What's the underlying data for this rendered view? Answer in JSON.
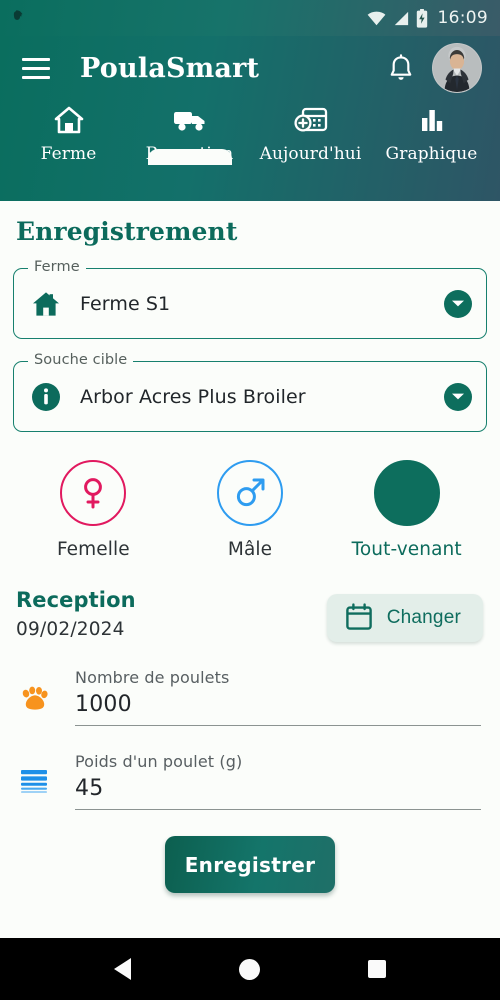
{
  "status_bar": {
    "notification_icon": "app-notification-icon",
    "wifi_icon": "wifi-icon",
    "signal_icon": "cellular-signal-icon",
    "battery_icon": "battery-charging-icon",
    "time": "16:09"
  },
  "app_bar": {
    "menu_icon": "hamburger-menu-icon",
    "title": "PoulaSmart",
    "notifications_icon": "bell-icon",
    "avatar_label": "avatar"
  },
  "tabs": {
    "active_index": 1,
    "items": [
      {
        "label": "Ferme",
        "icon": "home-icon"
      },
      {
        "label": "Reception",
        "icon": "truck-icon"
      },
      {
        "label": "Aujourd'hui",
        "icon": "calendar-plus-icon"
      },
      {
        "label": "Graphique",
        "icon": "bar-chart-icon"
      }
    ]
  },
  "main": {
    "page_title": "Enregistrement",
    "farm_field": {
      "legend": "Ferme",
      "value": "Ferme S1",
      "icon": "home-filled-icon",
      "caret": "chevron-down-icon"
    },
    "strain_field": {
      "legend": "Souche cible",
      "value": "Arbor Acres Plus Broiler",
      "icon": "info-icon",
      "caret": "chevron-down-icon"
    },
    "gender_options": [
      {
        "label": "Femelle",
        "icon": "female-symbol-icon",
        "selected": false,
        "color": "#e1195f"
      },
      {
        "label": "Mâle",
        "icon": "male-symbol-icon",
        "selected": false,
        "color": "#2e9cf0"
      },
      {
        "label": "Tout-venant",
        "icon": "filled-circle-icon",
        "selected": true,
        "color": "#0d6e5d"
      }
    ],
    "reception": {
      "title": "Reception",
      "date": "09/02/2024",
      "change_button_label": "Changer",
      "change_button_icon": "calendar-icon"
    },
    "inputs": [
      {
        "label": "Nombre de poulets",
        "value": "1000",
        "icon": "paw-icon",
        "icon_color": "#f7931e"
      },
      {
        "label": "Poids d'un poulet (g)",
        "value": "45",
        "icon": "lines-list-icon",
        "icon_color": "#1e90e8"
      }
    ],
    "submit_label": "Enregistrer"
  },
  "system_nav": {
    "back": "back-button",
    "home": "home-button",
    "recents": "recents-button"
  },
  "theme": {
    "primary": "#0c6b5c",
    "accent_pink": "#e1195f",
    "accent_blue": "#2e9cf0",
    "accent_orange": "#f7931e",
    "background": "#fbfdfa"
  }
}
